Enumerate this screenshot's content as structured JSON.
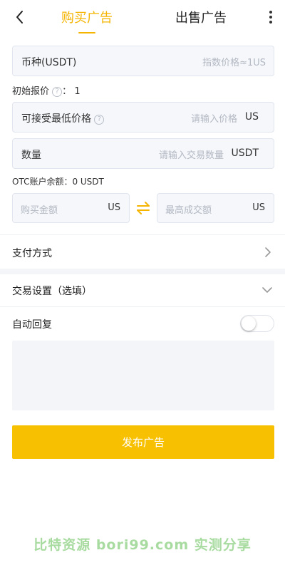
{
  "header": {
    "tab_buy": "购买广告",
    "tab_sell": "出售广告",
    "accent_color": "#f4b400"
  },
  "currency_field": {
    "label": "币种(USDT)",
    "value": "指数价格≈1US"
  },
  "initial_price": {
    "label": "初始报价",
    "separator": "：",
    "value": "1"
  },
  "min_price_field": {
    "label": "可接受最低价格",
    "placeholder": "请输入价格",
    "unit": "US"
  },
  "quantity_field": {
    "label": "数量",
    "placeholder": "请输入交易数量",
    "unit": "USDT"
  },
  "balance": {
    "text": "OTC账户余额：0 USDT"
  },
  "amount_fields": {
    "buy_amount_placeholder": "购买金额",
    "buy_amount_unit": "US",
    "max_amount_placeholder": "最高成交额",
    "max_amount_unit": "US"
  },
  "payment": {
    "label": "支付方式"
  },
  "trade_settings": {
    "label": "交易设置（选填）"
  },
  "auto_reply": {
    "label": "自动回复",
    "enabled": false
  },
  "submit": {
    "label": "发布广告",
    "color": "#f7c000"
  },
  "watermark": {
    "text": "比特资源 bori99.com 实测分享"
  },
  "icons": [
    "back-arrow-icon",
    "more-vertical-icon",
    "help-circle-icon",
    "swap-arrows-icon",
    "chevron-right-icon",
    "chevron-down-icon"
  ]
}
